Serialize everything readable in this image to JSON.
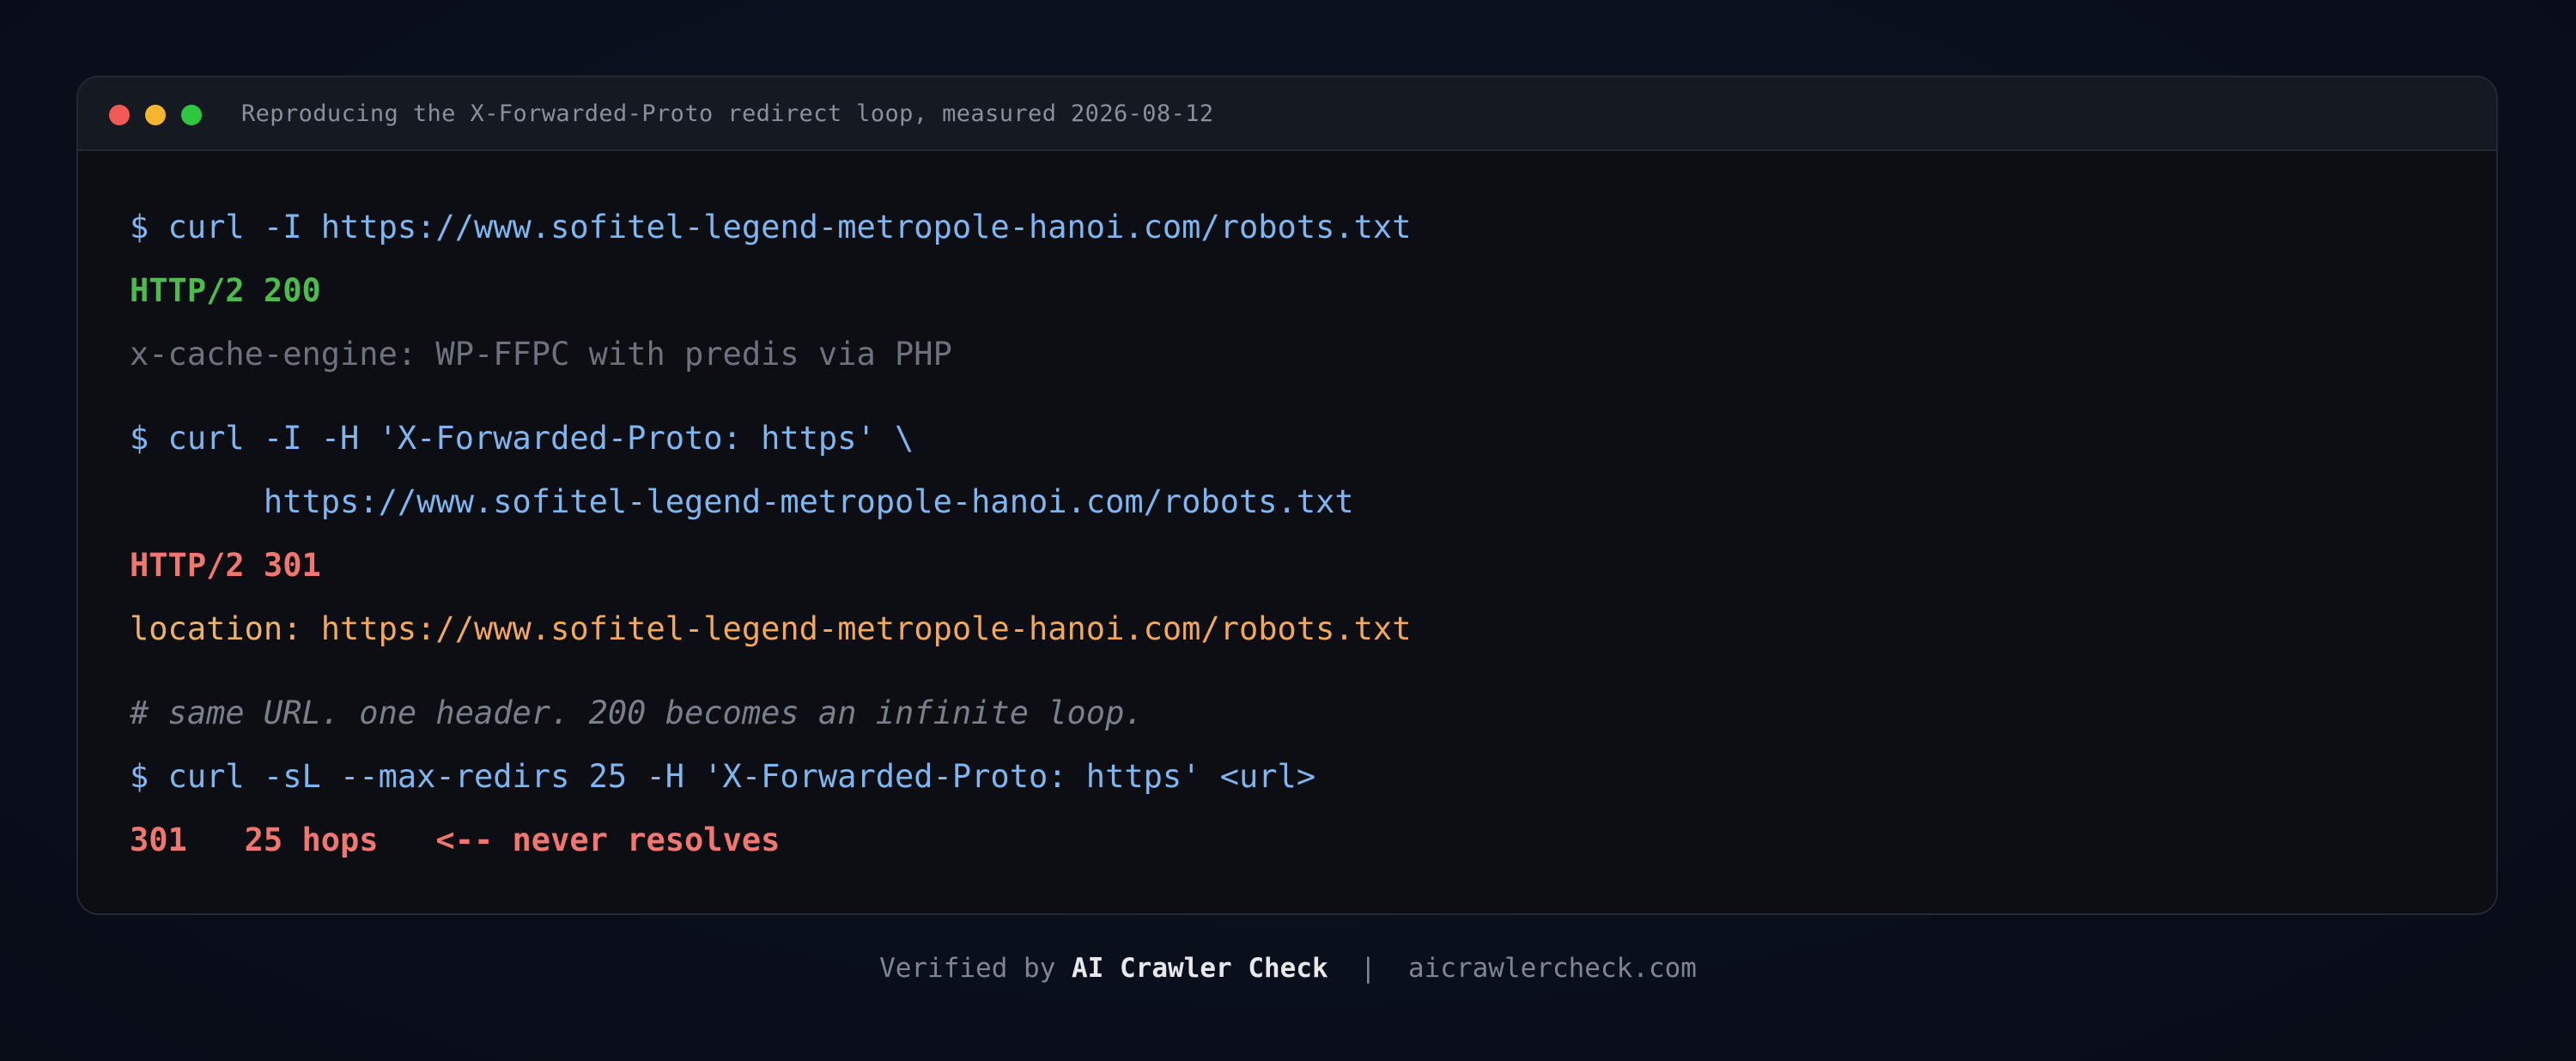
{
  "window": {
    "title": "Reproducing the X-Forwarded-Proto redirect loop, measured 2026-08-12",
    "controls": [
      "close-dot",
      "minimize-dot",
      "zoom-dot"
    ]
  },
  "terminal": {
    "block1": {
      "command": "$ curl -I https://www.sofitel-legend-metropole-hanoi.com/robots.txt",
      "status": "HTTP/2 200",
      "header": "x-cache-engine: WP-FFPC with predis via PHP"
    },
    "block2": {
      "command_line1": "$ curl -I -H 'X-Forwarded-Proto: https' \\",
      "command_line2": "       https://www.sofitel-legend-metropole-hanoi.com/robots.txt",
      "status": "HTTP/2 301",
      "location_key": "location: ",
      "location_value": "https://www.sofitel-legend-metropole-hanoi.com/robots.txt"
    },
    "block3": {
      "comment": "# same URL. one header. 200 becomes an infinite loop.",
      "command": "$ curl -sL --max-redirs 25 -H 'X-Forwarded-Proto: https' <url>",
      "result": "301   25 hops   <-- never resolves"
    }
  },
  "footer": {
    "prefix": "Verified by ",
    "brand": "AI Crawler Check",
    "separator": "  |  ",
    "domain": "aicrawlercheck.com"
  },
  "colors": {
    "background": "#0a0f1c",
    "window": "#0c0e14",
    "command": "#7fb6ef",
    "success": "#4cbc4e",
    "error": "#ef776f",
    "location": "#f2a85c",
    "muted": "#6d727c"
  }
}
